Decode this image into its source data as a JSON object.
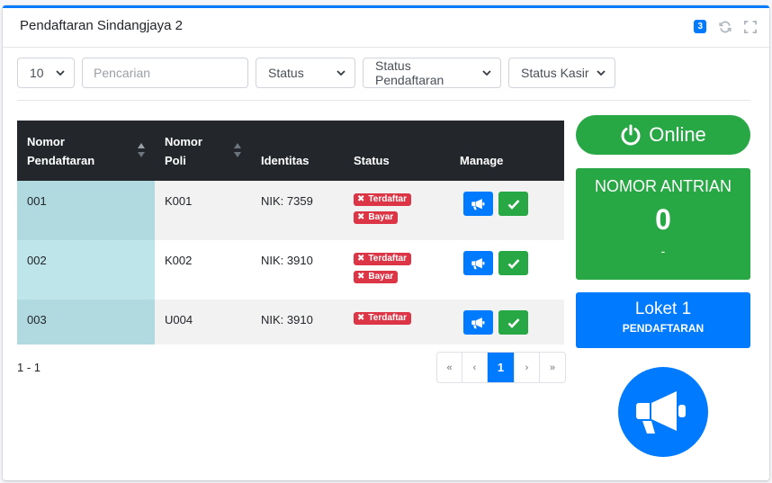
{
  "card": {
    "title": "Pendaftaran Sindangjaya 2",
    "badge_count": "3"
  },
  "filters": {
    "per_page": "10",
    "search_placeholder": "Pencarian",
    "status": "Status",
    "status_pendaftaran": "Status Pendaftaran",
    "status_kasir": "Status Kasir"
  },
  "table": {
    "headers": {
      "nomor_pendaftaran": "Nomor Pendaftaran",
      "nomor_poli": "Nomor Poli",
      "identitas": "Identitas",
      "status": "Status",
      "manage": "Manage"
    },
    "rows": [
      {
        "nomor": "001",
        "poli": "K001",
        "identitas": "NIK: 7359",
        "tags": [
          "Terdaftar",
          "Bayar"
        ]
      },
      {
        "nomor": "002",
        "poli": "K002",
        "identitas": "NIK: 3910",
        "tags": [
          "Terdaftar",
          "Bayar"
        ]
      },
      {
        "nomor": "003",
        "poli": "U004",
        "identitas": "NIK: 3910",
        "tags": [
          "Terdaftar"
        ]
      }
    ]
  },
  "footer": {
    "range": "1 - 1",
    "pager": {
      "first": "«",
      "prev": "‹",
      "current": "1",
      "next": "›",
      "last": "»"
    }
  },
  "side": {
    "online_label": "Online",
    "antrian_title": "NOMOR ANTRIAN",
    "antrian_number": "0",
    "antrian_sub": "-",
    "loket_title": "Loket 1",
    "loket_sub": "PENDAFTARAN"
  },
  "colors": {
    "primary": "#007bff",
    "success": "#28a745",
    "danger": "#dc3545",
    "table_head": "#23272b"
  },
  "icons": [
    "refresh-icon",
    "expand-icon",
    "chevron-down-icon",
    "sort-icon",
    "times-icon",
    "bullhorn-icon",
    "check-icon",
    "power-icon"
  ]
}
